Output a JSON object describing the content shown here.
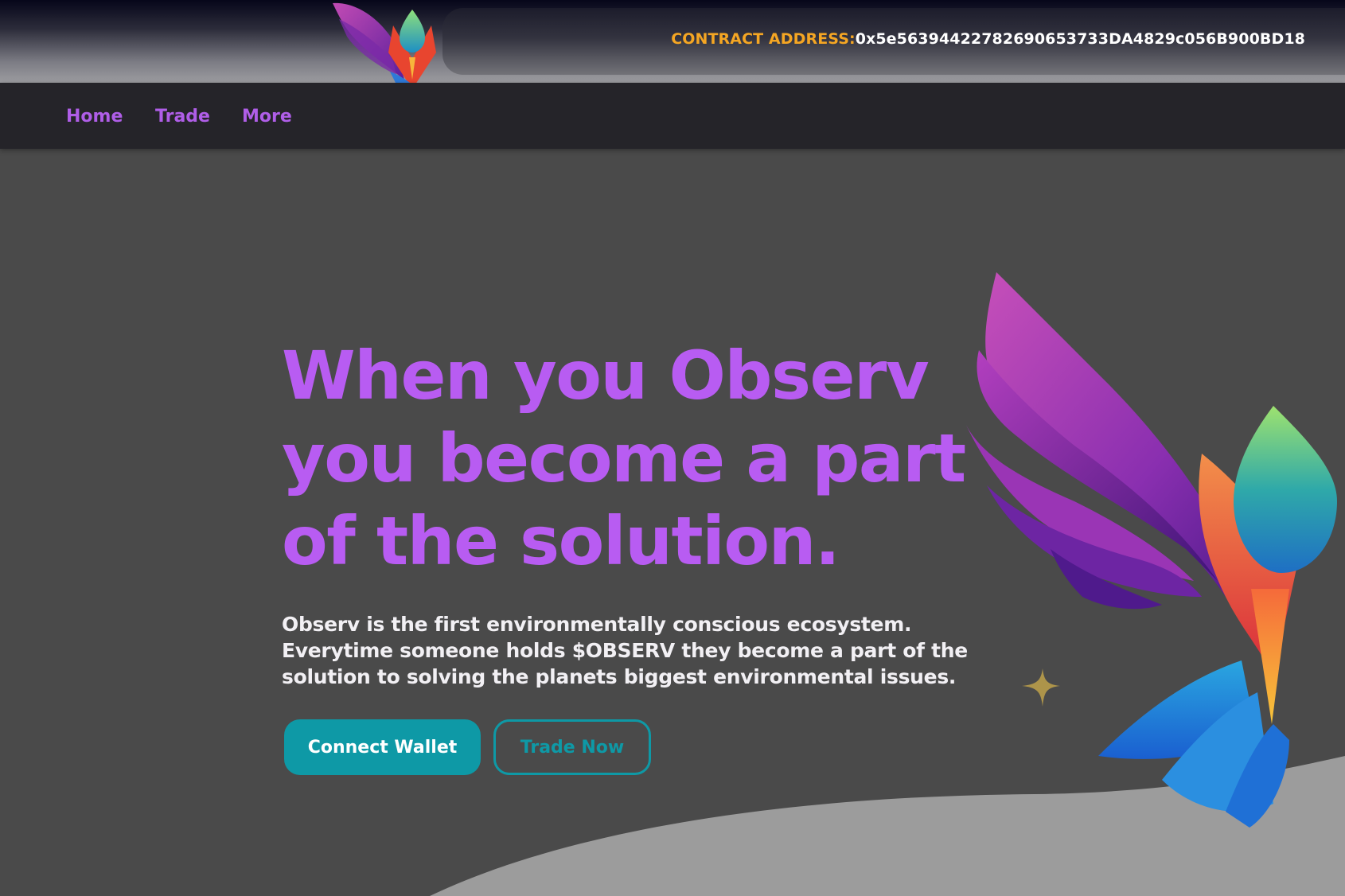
{
  "header": {
    "contract_label": "CONTRACT ADDRESS:",
    "contract_address": "0x5e56394422782690653733DA4829c056B900BD18"
  },
  "nav": {
    "items": [
      {
        "label": "Home"
      },
      {
        "label": "Trade"
      },
      {
        "label": "More"
      }
    ]
  },
  "hero": {
    "title_line1": "When you Observ",
    "title_line2": "you become a part",
    "title_line3": "of the solution.",
    "desc_line1": "Observ is the first environmentally conscious ecosystem.",
    "desc_line2": "Everytime someone holds $OBSERV they become a part of the",
    "desc_line3": "solution to solving the planets biggest environmental issues.",
    "connect_label": "Connect Wallet",
    "trade_label": "Trade Now"
  },
  "colors": {
    "accent_purple": "#b85cf2",
    "accent_teal": "#0e99a6",
    "contract_label": "#f5a623",
    "background": "#4a4a4a"
  },
  "icons": {
    "logo": "observ-phoenix-logo-icon",
    "hero_art": "phoenix-bird-icon",
    "sparkle": "sparkle-star-icon"
  }
}
